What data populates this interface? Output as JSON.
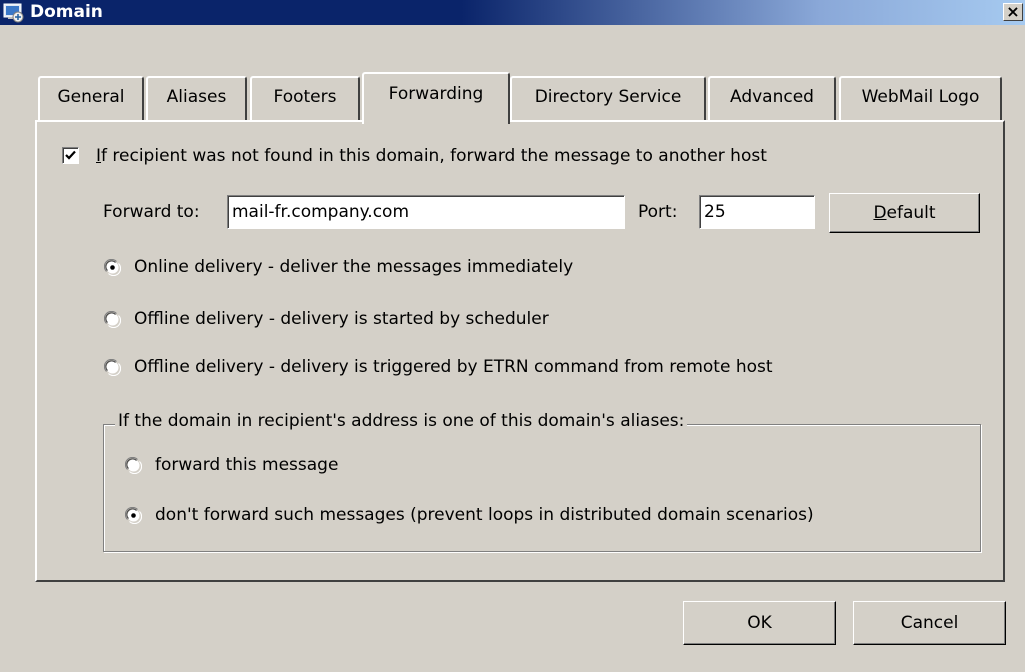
{
  "window": {
    "title": "Domain",
    "close_glyph": "×",
    "colors": {
      "titlebar": "#0a246a",
      "face": "#d4d0c8"
    }
  },
  "tabs": [
    {
      "label": "General",
      "active": false
    },
    {
      "label": "Aliases",
      "active": false
    },
    {
      "label": "Footers",
      "active": false
    },
    {
      "label": "Forwarding",
      "active": true
    },
    {
      "label": "Directory Service",
      "active": false
    },
    {
      "label": "Advanced",
      "active": false
    },
    {
      "label": "WebMail Logo",
      "active": false
    }
  ],
  "forwarding": {
    "enable_checkbox": {
      "checked": true,
      "mnemonic": "I",
      "label_rest": "f recipient was not found in this domain, forward the message to another host"
    },
    "forward_to_label": "Forward to:",
    "forward_to_value": "mail-fr.company.com",
    "port_label": "Port:",
    "port_value": "25",
    "default_button": {
      "mnemonic": "D",
      "rest": "efault"
    },
    "delivery_options": [
      {
        "label": "Online delivery - deliver the messages immediately",
        "selected": true
      },
      {
        "label": "Offline delivery - delivery is started by scheduler",
        "selected": false
      },
      {
        "label": "Offline delivery - delivery is triggered by ETRN command from remote host",
        "selected": false
      }
    ],
    "aliases_group": {
      "legend": "If the domain in recipient's address is one of this domain's aliases:",
      "options": [
        {
          "label": "forward this message",
          "selected": false
        },
        {
          "label": "don't forward such messages (prevent loops in distributed domain scenarios)",
          "selected": true
        }
      ]
    }
  },
  "footer": {
    "ok_label": "OK",
    "cancel_label": "Cancel"
  }
}
